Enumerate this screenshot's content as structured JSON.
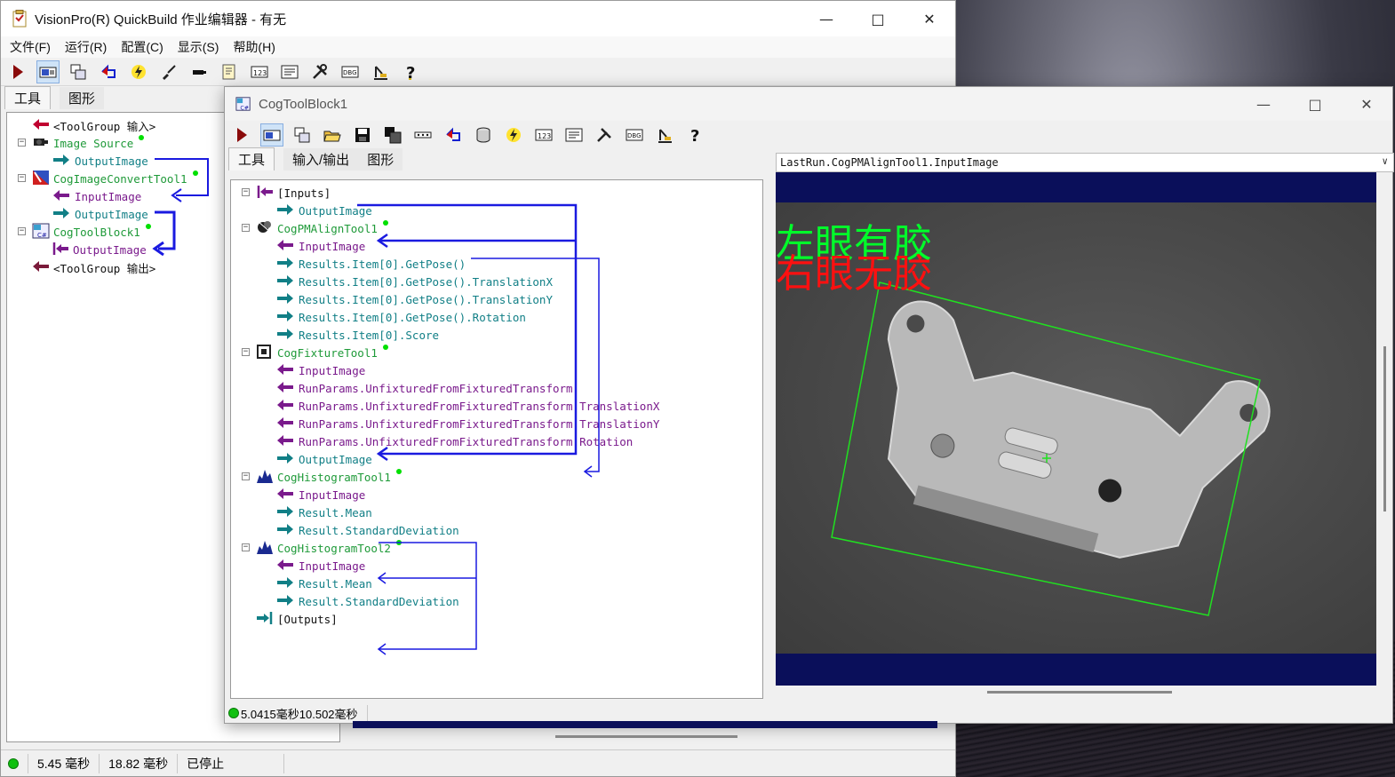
{
  "main": {
    "title": "VisionPro(R) QuickBuild 作业编辑器 - 有无",
    "menu": [
      "文件(F)",
      "运行(R)",
      "配置(C)",
      "显示(S)",
      "帮助(H)"
    ],
    "tabs": [
      "工具",
      "图形"
    ],
    "tree": [
      {
        "label": "<ToolGroup 输入>",
        "color": "black"
      },
      {
        "label": "Image Source",
        "color": "green",
        "status": true
      },
      {
        "label": "OutputImage",
        "color": "teal"
      },
      {
        "label": "CogImageConvertTool1",
        "color": "green",
        "status": true
      },
      {
        "label": "InputImage",
        "color": "purple"
      },
      {
        "label": "OutputImage",
        "color": "teal"
      },
      {
        "label": "CogToolBlock1",
        "color": "green",
        "status": true
      },
      {
        "label": "OutputImage",
        "color": "purple"
      },
      {
        "label": "<ToolGroup 输出>",
        "color": "black"
      }
    ],
    "status": {
      "time1": "5.45 毫秒",
      "time2": "18.82 毫秒",
      "state": "已停止"
    }
  },
  "toolblock": {
    "title": "CogToolBlock1",
    "tabs": [
      "工具",
      "输入/输出",
      "图形"
    ],
    "image_selector": "LastRun.CogPMAlignTool1.InputImage",
    "tree": [
      {
        "label": "[Inputs]",
        "color": "black"
      },
      {
        "label": "OutputImage",
        "color": "teal"
      },
      {
        "label": "CogPMAlignTool1",
        "color": "green",
        "status": true
      },
      {
        "label": "InputImage",
        "color": "purple"
      },
      {
        "label": "Results.Item[0].GetPose()",
        "color": "teal"
      },
      {
        "label": "Results.Item[0].GetPose().TranslationX",
        "color": "teal"
      },
      {
        "label": "Results.Item[0].GetPose().TranslationY",
        "color": "teal"
      },
      {
        "label": "Results.Item[0].GetPose().Rotation",
        "color": "teal"
      },
      {
        "label": "Results.Item[0].Score",
        "color": "teal"
      },
      {
        "label": "CogFixtureTool1",
        "color": "green",
        "status": true
      },
      {
        "label": "InputImage",
        "color": "purple"
      },
      {
        "label": "RunParams.UnfixturedFromFixturedTransform",
        "color": "purple"
      },
      {
        "label": "RunParams.UnfixturedFromFixturedTransform.TranslationX",
        "color": "purple"
      },
      {
        "label": "RunParams.UnfixturedFromFixturedTransform.TranslationY",
        "color": "purple"
      },
      {
        "label": "RunParams.UnfixturedFromFixturedTransform.Rotation",
        "color": "purple"
      },
      {
        "label": "OutputImage",
        "color": "teal"
      },
      {
        "label": "CogHistogramTool1",
        "color": "green",
        "status": true
      },
      {
        "label": "InputImage",
        "color": "purple"
      },
      {
        "label": "Result.Mean",
        "color": "teal"
      },
      {
        "label": "Result.StandardDeviation",
        "color": "teal"
      },
      {
        "label": "CogHistogramTool2",
        "color": "green",
        "status": true
      },
      {
        "label": "InputImage",
        "color": "purple"
      },
      {
        "label": "Result.Mean",
        "color": "teal"
      },
      {
        "label": "Result.StandardDeviation",
        "color": "teal"
      },
      {
        "label": "[Outputs]",
        "color": "black"
      }
    ],
    "overlay": {
      "text_green": "左眼有胶",
      "text_red": "右眼无胶"
    },
    "status_time": "5.0415毫秒10.502毫秒"
  },
  "colors": {
    "wire": "#1a1ae0",
    "teal": "#117f86",
    "purple": "#7a1a8c",
    "green": "#1f9a39",
    "image_bg": "#0a0f5a",
    "overlay_green": "#00ff2a",
    "overlay_red": "#ff1010"
  }
}
